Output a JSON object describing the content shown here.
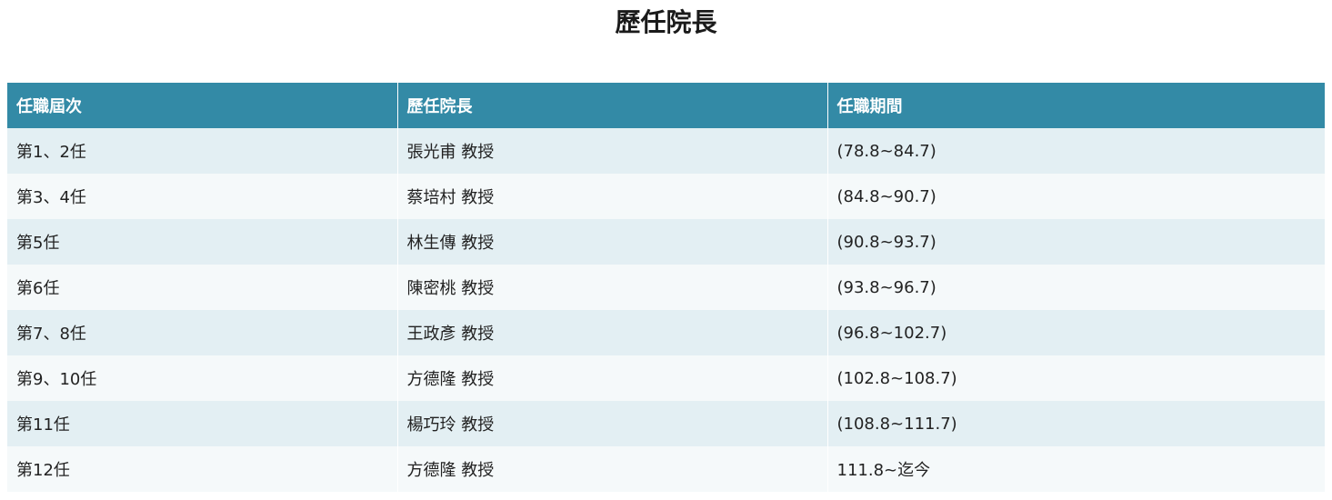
{
  "page": {
    "title": "歷任院長"
  },
  "table": {
    "headers": [
      "任職屆次",
      "歷任院長",
      "任職期間"
    ],
    "rows": [
      {
        "term": "第1、2任",
        "name": "張光甫 教授",
        "period": "(78.8~84.7)"
      },
      {
        "term": "第3、4任",
        "name": "蔡培村 教授",
        "period": "(84.8~90.7)"
      },
      {
        "term": "第5任",
        "name": "林生傳 教授",
        "period": "(90.8~93.7)"
      },
      {
        "term": "第6任",
        "name": "陳密桃 教授",
        "period": "(93.8~96.7)"
      },
      {
        "term": "第7、8任",
        "name": "王政彥 教授",
        "period": "(96.8~102.7)"
      },
      {
        "term": "第9、10任",
        "name": "方德隆 教授",
        "period": "(102.8~108.7)"
      },
      {
        "term": "第11任",
        "name": "楊巧玲 教授",
        "period": "(108.8~111.7)"
      },
      {
        "term": "第12任",
        "name": "方德隆 教授",
        "period": "111.8~迄今"
      }
    ]
  },
  "colors": {
    "header_background": "#338aa6",
    "header_text": "#ffffff",
    "row_odd_background": "#e3eff3",
    "row_even_background": "#f5f9fa"
  }
}
